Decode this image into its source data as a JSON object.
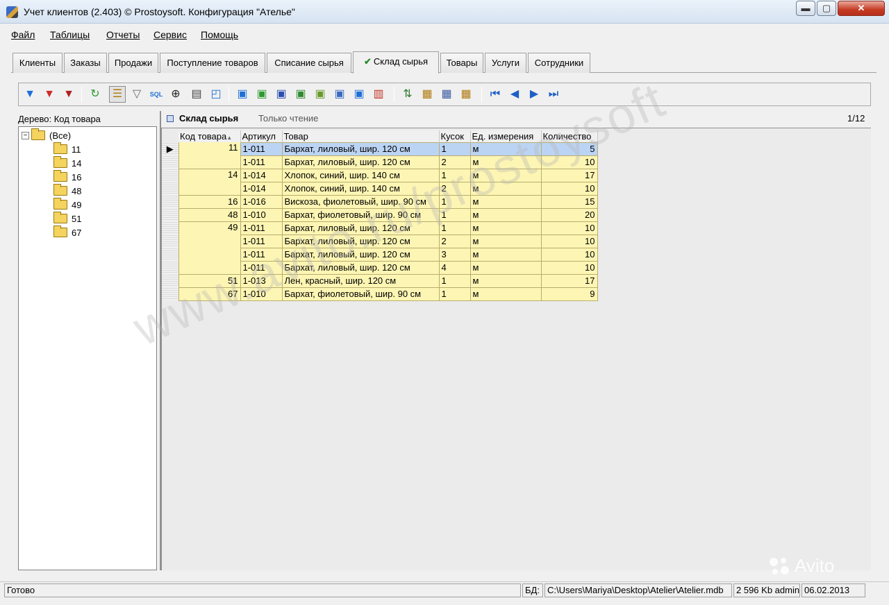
{
  "window": {
    "title": "Учет клиентов (2.403) © Prostoysoft. Конфигурация \"Ателье\"",
    "min_glyph": "▬",
    "max_glyph": "▢",
    "close_glyph": "✕"
  },
  "menu": [
    "Файл",
    "Таблицы",
    "Отчеты",
    "Сервис",
    "Помощь"
  ],
  "tabs": [
    {
      "label": "Клиенты",
      "active": false
    },
    {
      "label": "Заказы",
      "active": false
    },
    {
      "label": "Продажи",
      "active": false
    },
    {
      "label": "Поступление товаров",
      "active": false
    },
    {
      "label": "Списание сырья",
      "active": false
    },
    {
      "label": "Склад сырья",
      "active": true,
      "check": "✔"
    },
    {
      "label": "Товары",
      "active": false
    },
    {
      "label": "Услуги",
      "active": false
    },
    {
      "label": "Сотрудники",
      "active": false
    }
  ],
  "toolbar": {
    "sql_label": "SQL",
    "icons": [
      "filter-icon",
      "filter-add-icon",
      "filter-clear-icon",
      "refresh-icon",
      "tree-view-icon",
      "filter-by-value-icon",
      "sql-filter-icon",
      "find-icon",
      "print-icon",
      "print-preview-icon",
      "export-html-icon",
      "export-xls-icon",
      "export-word-icon",
      "export-excel-icon",
      "export-csv-icon",
      "export-pdf-icon",
      "export-report-icon",
      "chart-icon",
      "sort-icon",
      "column-settings-icon",
      "grid-settings-icon",
      "filter-columns-icon",
      "first-record-icon",
      "prev-record-icon",
      "next-record-icon",
      "last-record-icon"
    ]
  },
  "tree": {
    "caption": "Дерево: Код товара",
    "root": "(Все)",
    "expander": "−",
    "items": [
      "11",
      "14",
      "16",
      "48",
      "49",
      "51",
      "67"
    ]
  },
  "grid": {
    "title": "Склад сырья",
    "readonly": "Только чтение",
    "counter": "1/12",
    "sort_marker": "▲",
    "row_pointer": "▶",
    "columns": [
      "Код товара",
      "Артикул",
      "Товар",
      "Кусок",
      "Ед. измерения",
      "Количество"
    ],
    "rows": [
      {
        "code": "11",
        "art": "1-011",
        "name": "Бархат, лиловый, шир. 120 см",
        "piece": "1",
        "unit": "м",
        "qty": "5"
      },
      {
        "code": "",
        "art": "1-011",
        "name": "Бархат, лиловый, шир. 120 см",
        "piece": "2",
        "unit": "м",
        "qty": "10"
      },
      {
        "code": "14",
        "art": "1-014",
        "name": "Хлопок, синий, шир. 140 см",
        "piece": "1",
        "unit": "м",
        "qty": "17"
      },
      {
        "code": "",
        "art": "1-014",
        "name": "Хлопок, синий, шир. 140 см",
        "piece": "2",
        "unit": "м",
        "qty": "10"
      },
      {
        "code": "16",
        "art": "1-016",
        "name": "Вискоза, фиолетовый, шир. 90 см",
        "piece": "1",
        "unit": "м",
        "qty": "15"
      },
      {
        "code": "48",
        "art": "1-010",
        "name": "Бархат, фиолетовый, шир. 90 см",
        "piece": "1",
        "unit": "м",
        "qty": "20"
      },
      {
        "code": "49",
        "art": "1-011",
        "name": "Бархат, лиловый, шир. 120 см",
        "piece": "1",
        "unit": "м",
        "qty": "10"
      },
      {
        "code": "",
        "art": "1-011",
        "name": "Бархат, лиловый, шир. 120 см",
        "piece": "2",
        "unit": "м",
        "qty": "10"
      },
      {
        "code": "",
        "art": "1-011",
        "name": "Бархат, лиловый, шир. 120 см",
        "piece": "3",
        "unit": "м",
        "qty": "10"
      },
      {
        "code": "",
        "art": "1-011",
        "name": "Бархат, лиловый, шир. 120 см",
        "piece": "4",
        "unit": "м",
        "qty": "10"
      },
      {
        "code": "51",
        "art": "1-013",
        "name": "Лен, красный, шир. 120 см",
        "piece": "1",
        "unit": "м",
        "qty": "17"
      },
      {
        "code": "67",
        "art": "1-010",
        "name": "Бархат, фиолетовый, шир. 90 см",
        "piece": "1",
        "unit": "м",
        "qty": "9"
      }
    ]
  },
  "status": {
    "text": "Готово",
    "db_label": "БД:",
    "db_path": "C:\\Users\\Mariya\\Desktop\\Atelier\\Atelier.mdb",
    "size_user": "2 596 Kb admin",
    "date": "06.02.2013"
  },
  "watermark": {
    "text": "www.avito.ru/prostoysoft",
    "avito": "Avito"
  },
  "colors": {
    "row_yellow": "#fdf5b3",
    "row_selected": "#bcd4f4",
    "check_green": "#2f8a2f"
  }
}
